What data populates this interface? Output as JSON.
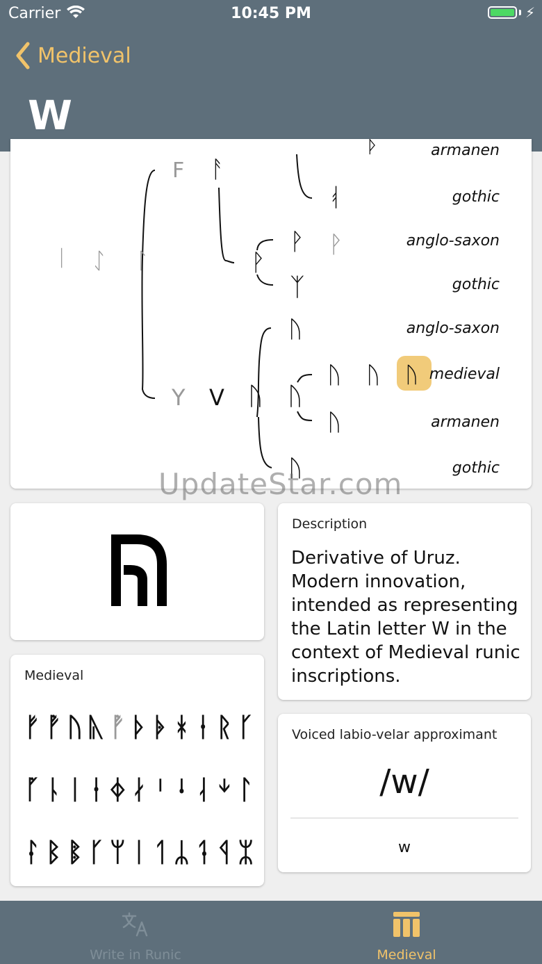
{
  "status_bar": {
    "carrier": "Carrier",
    "time": "10:45 PM"
  },
  "nav": {
    "back_label": "Medieval",
    "title": "W"
  },
  "tree": {
    "nodes_left": {
      "a": "ᛁ",
      "b": "ᛇ",
      "c": "ᛚ"
    },
    "branch_top": {
      "faded": "F",
      "rune": "ᚨ"
    },
    "branch_bottom": {
      "faded": "Y",
      "v": "V",
      "u": "ᚢ",
      "n": "ᚢ"
    },
    "rows": [
      {
        "rune": "ᚦ",
        "label": "armanen"
      },
      {
        "rune": "ᚮ",
        "label": "gothic"
      },
      {
        "rune": "ᚹ",
        "faded": "ᚹ",
        "label": "anglo-saxon"
      },
      {
        "rune": "ᛉ",
        "label": "gothic"
      },
      {
        "rune": "ᚢ",
        "label": "anglo-saxon"
      },
      {
        "runes": [
          "ᚢ",
          "ᚢ",
          "ᚢ"
        ],
        "label": "medieval"
      },
      {
        "rune": "ᚢ",
        "label": "armanen"
      },
      {
        "rune": "ᚢ",
        "label": "gothic"
      }
    ],
    "accent_color": "#f1cb7a"
  },
  "watermark": "UpdateStar.com",
  "rune_card": {
    "rune": "ᚡ"
  },
  "description": {
    "label": "Description",
    "text": "Derivative of Uruz. Modern innovation, intended as representing the Latin letter W in the context of Medieval runic inscriptions."
  },
  "alphabet": {
    "label": "Medieval",
    "rows": [
      [
        "ᚠ",
        "ᚡ",
        "ᚢ",
        "ᚣ",
        "ᚡ",
        "ᚦ",
        "ᚧ",
        "ᚼ",
        "ᚽ",
        "ᚱ",
        "ᚴ"
      ],
      [
        "ᚵ",
        "ᚿ",
        "ᛁ",
        "ᛂ",
        "ᛄ",
        "ᛅ",
        "ᛌ",
        "ᛍ",
        "ᛆ",
        "ᛎ",
        "ᛚ"
      ],
      [
        "ᛛ",
        "ᛒ",
        "ᛔ",
        "ᚴ",
        "ᛘ",
        "ᛁ",
        "ᛐ",
        "ᛦ",
        "ᛑ",
        "ᛩ",
        "ᛯ"
      ]
    ],
    "current_index": 4
  },
  "phonetics": {
    "label": "Voiced labio-velar approximant",
    "ipa": "/w/",
    "latin": "w"
  },
  "tabbar": {
    "tabs": [
      {
        "label": "Write in Runic",
        "icon": "translate-icon",
        "active": false
      },
      {
        "label": "Medieval",
        "icon": "table-columns-icon",
        "active": true
      }
    ],
    "active_color": "#f1c36a",
    "inactive_color": "#7f8e98"
  },
  "colors": {
    "bar": "#5e6f7b",
    "accent": "#f1c36a"
  }
}
